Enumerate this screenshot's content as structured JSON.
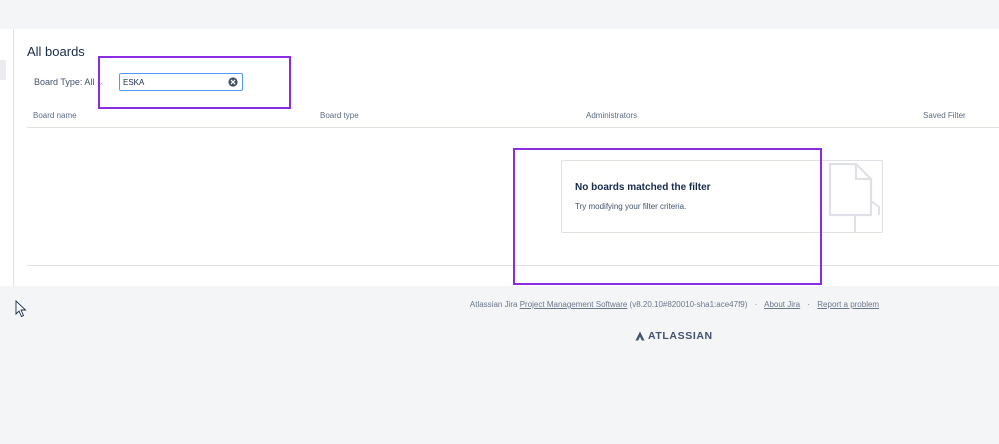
{
  "page": {
    "title": "All boards"
  },
  "filters": {
    "board_type_label": "Board Type: All",
    "search_value": "ESKA"
  },
  "table": {
    "columns": [
      "Board name",
      "Board type",
      "Administrators",
      "Saved Filter"
    ]
  },
  "empty_state": {
    "title": "No boards matched the filter",
    "subtitle": "Try modifying your filter criteria."
  },
  "footer": {
    "prefix": "Atlassian Jira",
    "product_link": "Project Management Software",
    "version": "(v8.20.10#820010-sha1:ace47f9)",
    "about_link": "About Jira",
    "report_link": "Report a problem",
    "separator": "·",
    "logo_text": "ATLASSIAN"
  },
  "icons": {
    "clear": "clear-circle-icon",
    "caret": "chevron-down-icon",
    "empty": "document-icon",
    "logo": "atlassian-logo-icon",
    "cursor": "mouse-pointer-icon"
  },
  "colors": {
    "highlight": "#8b2be2",
    "focus_border": "#4c9aff",
    "text_primary": "#172b4d",
    "text_secondary": "#5e6c84",
    "page_bg": "#f4f5f7"
  }
}
